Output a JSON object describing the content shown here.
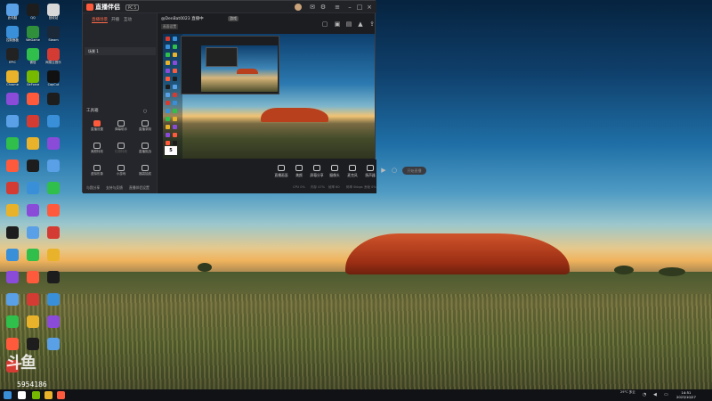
{
  "desktop_icons": [
    {
      "label": "此电脑",
      "color": "#5aa0e6"
    },
    {
      "label": "QQ",
      "color": "#1d1d1d"
    },
    {
      "label": "回收站",
      "color": "#d8d8d8"
    },
    {
      "label": "控制面板",
      "color": "#3a8fd9"
    },
    {
      "label": "WeGame",
      "color": "#2f8f3a"
    },
    {
      "label": "Steam",
      "color": "#1b2838"
    },
    {
      "label": "EPIC",
      "color": "#222222"
    },
    {
      "label": "微信",
      "color": "#2fbf4a"
    },
    {
      "label": "网易云音乐",
      "color": "#d43c33"
    },
    {
      "label": "Chrome",
      "color": "#e8b32a"
    },
    {
      "label": "GeForce",
      "color": "#76b900"
    },
    {
      "label": "CapCut",
      "color": "#111111"
    }
  ],
  "app": {
    "brand": "直播伴侣",
    "version": "PC 5",
    "tabs": [
      "直播场景",
      "开播",
      "互动"
    ],
    "scene_item": "场景 1",
    "tools_title": "工具箱",
    "tools": [
      {
        "label": "直播设置",
        "dim": false,
        "hot": true
      },
      {
        "label": "弹幕助手",
        "dim": false,
        "hot": false
      },
      {
        "label": "直播录制",
        "dim": false,
        "hot": false
      },
      {
        "label": "美颜特效",
        "dim": false,
        "hot": false
      },
      {
        "label": "礼物特效",
        "dim": true,
        "hot": false
      },
      {
        "label": "直播挑战",
        "dim": false,
        "hot": false
      },
      {
        "label": "虚拟形象",
        "dim": false,
        "hot": false
      },
      {
        "label": "小游戏",
        "dim": false,
        "hot": false
      },
      {
        "label": "福袋抽奖",
        "dim": false,
        "hot": false
      }
    ],
    "bottom_links": [
      "与我分享",
      "支持与反馈",
      "直播伴侣设置",
      "更多功能"
    ],
    "room_title": "@DenBat0023 直播中",
    "room_badge": "游戏",
    "room_sub": "画面设置",
    "preview_label": "5",
    "controls": [
      "直播画面",
      "美颜",
      "屏幕分享",
      "摄像头",
      "麦克风",
      "扬声器"
    ],
    "start_label": "开始直播",
    "stats": [
      "CPU 0%",
      "内存 47%",
      "帧率 60",
      "码率 0kbps",
      "丢帧 0%"
    ]
  },
  "watermark": {
    "logo": "斗鱼",
    "id": "5954186"
  },
  "taskbar": {
    "tray_text": "29°C 多云",
    "time": "14:51",
    "date": "2023/10/27"
  }
}
